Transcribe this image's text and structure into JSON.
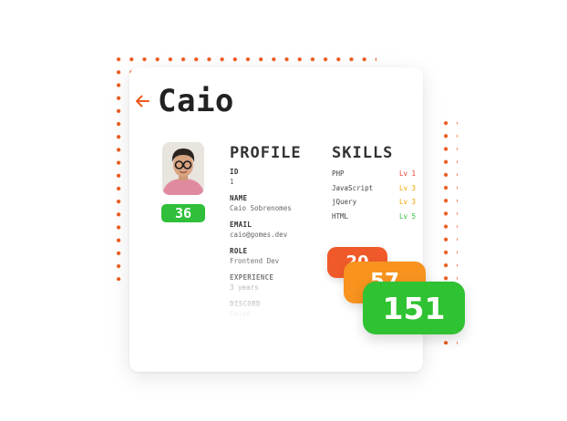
{
  "profile_page": {
    "name": "Caio",
    "level": "36",
    "avatar": "profile-photo-icon",
    "sections": {
      "profile": "PROFILE",
      "skills": "SKILLS"
    },
    "fields": [
      {
        "label": "ID",
        "value": "1"
      },
      {
        "label": "NAME",
        "value": "Caio Sobrenomes"
      },
      {
        "label": "EMAIL",
        "value": "caio@gomes.dev"
      },
      {
        "label": "ROLE",
        "value": "Frontend Dev"
      },
      {
        "label": "EXPERIENCE",
        "value": "3 years"
      },
      {
        "label": "DISCORD",
        "value": "Caio#"
      }
    ],
    "skills": [
      {
        "name": "PHP",
        "level": "Lv 1",
        "color": "#e8412b"
      },
      {
        "name": "JavaScript",
        "level": "Lv 3",
        "color": "#f2a300"
      },
      {
        "name": "jQuery",
        "level": "Lv 3",
        "color": "#f2a300"
      },
      {
        "name": "HTML",
        "level": "Lv 5",
        "color": "#2fbf3a"
      }
    ]
  },
  "score_bubbles": [
    {
      "value": "20",
      "color": "#f05a2a"
    },
    {
      "value": "57",
      "color": "#f7931e"
    },
    {
      "value": "151",
      "color": "#2fc232"
    }
  ],
  "colors": {
    "accent": "#ee5a1e",
    "level_badge": "#2fbf3a"
  }
}
